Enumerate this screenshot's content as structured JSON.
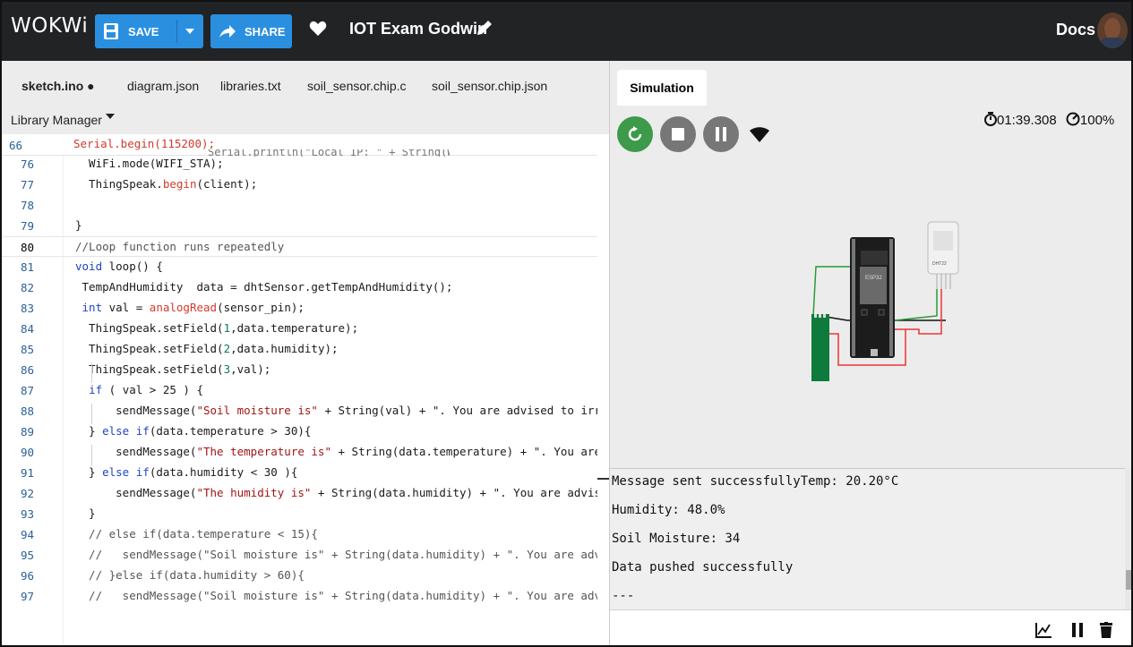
{
  "header": {
    "logo": "WOKWi",
    "save_label": "SAVE",
    "share_label": "SHARE",
    "project_title": "IOT Exam Godwin",
    "docs_label": "Docs"
  },
  "editor": {
    "tabs": [
      "sketch.ino ●",
      "diagram.json",
      "libraries.txt",
      "soil_sensor.chip.c",
      "soil_sensor.chip.json"
    ],
    "library_manager": "Library Manager",
    "sticky_line": {
      "num": "66",
      "text": "Serial.begin(115200);"
    },
    "lines": [
      {
        "num": "76",
        "text": "  WiFi.mode(WIFI_STA);"
      },
      {
        "num": "77",
        "text": "  ThingSpeak.begin(client);"
      },
      {
        "num": "78",
        "text": ""
      },
      {
        "num": "79",
        "text": "}"
      },
      {
        "num": "80",
        "text": "//Loop function runs repeatedly"
      },
      {
        "num": "81",
        "text": "void loop() {"
      },
      {
        "num": "82",
        "text": " TempAndHumidity  data = dhtSensor.getTempAndHumidity();"
      },
      {
        "num": "83",
        "text": " int val = analogRead(sensor_pin);"
      },
      {
        "num": "84",
        "text": "  ThingSpeak.setField(1,data.temperature);"
      },
      {
        "num": "85",
        "text": "  ThingSpeak.setField(2,data.humidity);"
      },
      {
        "num": "86",
        "text": "  ThingSpeak.setField(3,val);"
      },
      {
        "num": "87",
        "text": "  if ( val > 25 ) {"
      },
      {
        "num": "88",
        "text": "      sendMessage(\"Soil moisture is\" + String(val) + \". You are advised to irr"
      },
      {
        "num": "89",
        "text": "  } else if(data.temperature > 30){"
      },
      {
        "num": "90",
        "text": "      sendMessage(\"The temperature is\" + String(data.temperature) + \". You are"
      },
      {
        "num": "91",
        "text": "  } else if(data.humidity < 30 ){"
      },
      {
        "num": "92",
        "text": "      sendMessage(\"The humidity is\" + String(data.humidity) + \". You are advis"
      },
      {
        "num": "93",
        "text": "  }"
      },
      {
        "num": "94",
        "text": "  // else if(data.temperature < 15){"
      },
      {
        "num": "95",
        "text": "  //   sendMessage(\"Soil moisture is\" + String(data.humidity) + \". You are adv"
      },
      {
        "num": "96",
        "text": "  // }else if(data.humidity > 60){"
      },
      {
        "num": "97",
        "text": "  //   sendMessage(\"Soil moisture is\" + String(data.humidity) + \". You are adv"
      }
    ]
  },
  "simulation": {
    "tab_label": "Simulation",
    "timer": "01:39.308",
    "speed": "100%",
    "chip_label": "ESP32",
    "sensor_label": "DHT22"
  },
  "serial": {
    "lines": [
      "Message sent successfullyTemp: 20.20°C",
      "Humidity: 48.0%",
      "Soil Moisture: 34",
      "Data pushed successfully",
      "---"
    ]
  },
  "colors": {
    "topbar": "#222325",
    "accent": "#2b8fe0",
    "run_green": "#3d9a4a"
  }
}
